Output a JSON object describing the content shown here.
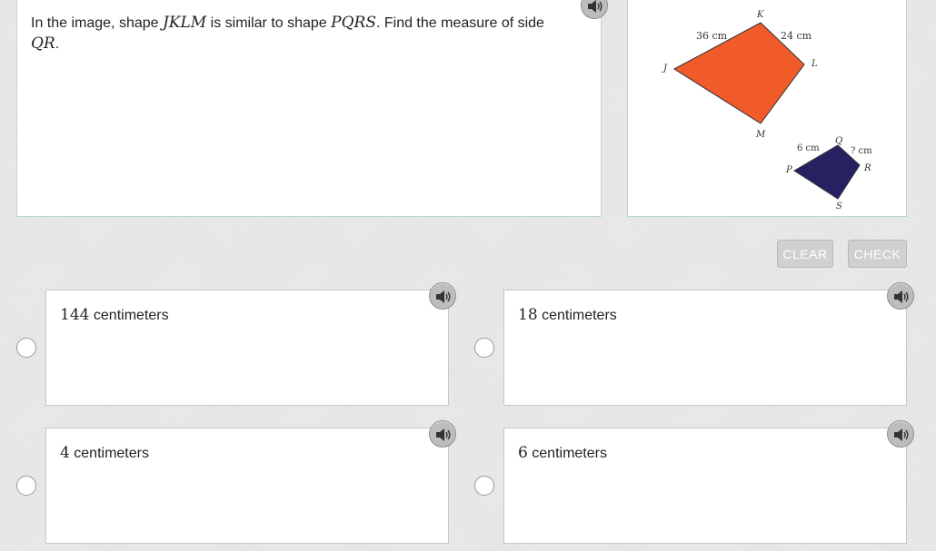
{
  "question": {
    "prefix": "In the image, shape ",
    "shape1": "JKLM",
    "middle": " is similar to shape ",
    "shape2": "PQRS",
    "suffix": ". Find the measure of side ",
    "side": "QR",
    "end": "."
  },
  "figure": {
    "large_shape": {
      "vertices": [
        "J",
        "K",
        "L",
        "M"
      ],
      "color": "#f15a29",
      "label_jk": "36 cm",
      "label_kl": "24 cm"
    },
    "small_shape": {
      "vertices": [
        "P",
        "Q",
        "R",
        "S"
      ],
      "color": "#262262",
      "label_pq": "6 cm",
      "label_qr": "? cm"
    }
  },
  "buttons": {
    "clear": "CLEAR",
    "check": "CHECK"
  },
  "choices": [
    {
      "number": "144",
      "unit": " centimeters"
    },
    {
      "number": "18",
      "unit": " centimeters"
    },
    {
      "number": "4",
      "unit": " centimeters"
    },
    {
      "number": "6",
      "unit": " centimeters"
    }
  ],
  "icons": {
    "speaker": "speaker-icon",
    "radio": "radio-button"
  }
}
